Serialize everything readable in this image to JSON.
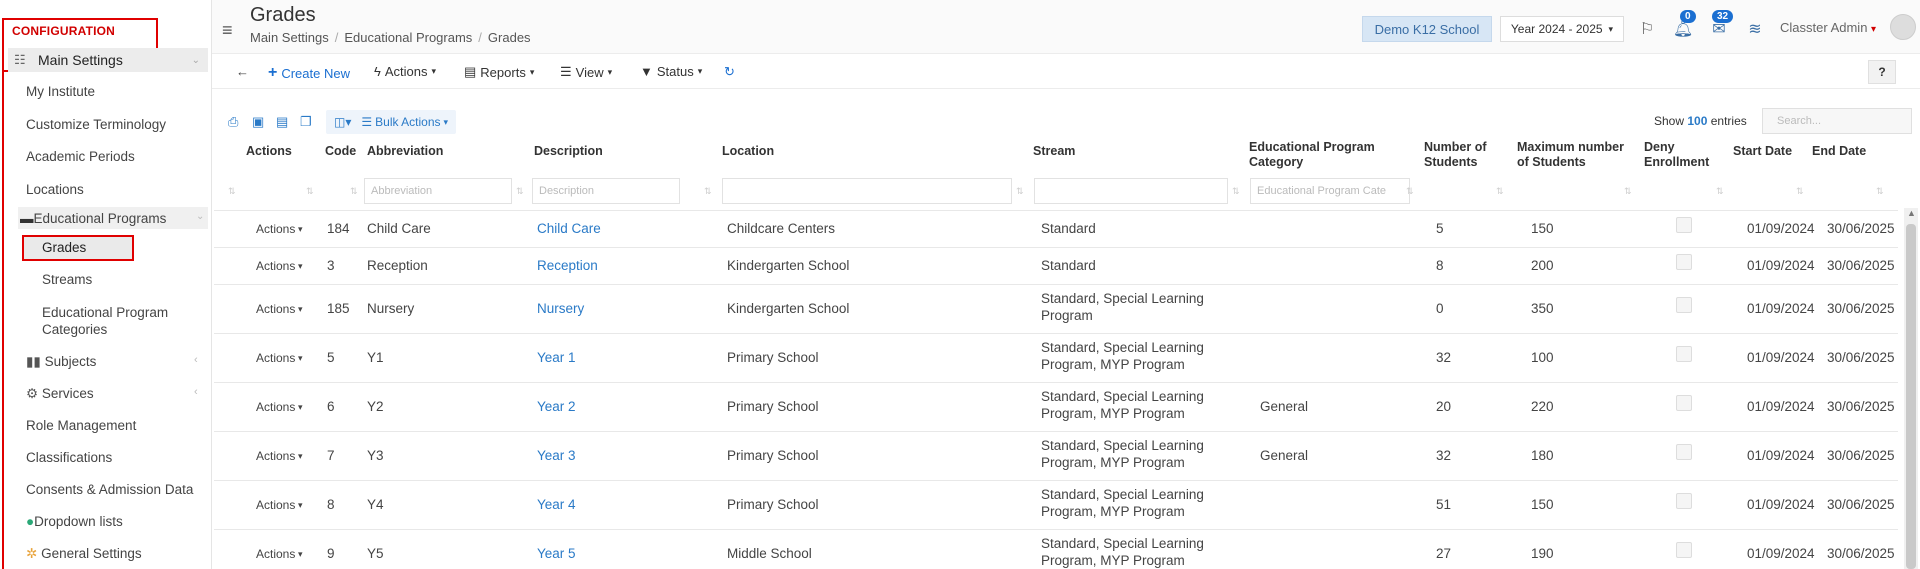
{
  "sidebar": {
    "section_title": "CONFIGURATION",
    "main_settings_label": "Main Settings",
    "items": [
      {
        "label": "My Institute"
      },
      {
        "label": "Customize Terminology"
      },
      {
        "label": "Academic Periods"
      },
      {
        "label": "Locations"
      },
      {
        "label": "Educational Programs"
      },
      {
        "label": "Grades"
      },
      {
        "label": "Streams"
      },
      {
        "label": "Educational Program Categories"
      },
      {
        "label": "Subjects"
      },
      {
        "label": "Services"
      },
      {
        "label": "Role Management"
      },
      {
        "label": "Classifications"
      },
      {
        "label": "Consents & Admission Data"
      },
      {
        "label": "Dropdown lists"
      },
      {
        "label": "General Settings"
      }
    ]
  },
  "header": {
    "title": "Grades",
    "breadcrumb": [
      "Main Settings",
      "Educational Programs",
      "Grades"
    ],
    "school": "Demo K12 School",
    "year": "Year 2024 - 2025",
    "notifications_count": "0",
    "messages_count": "32",
    "user": "Classter Admin"
  },
  "toolbar": {
    "create_new": "Create New",
    "actions": "Actions",
    "reports": "Reports",
    "view": "View",
    "status": "Status",
    "help": "?"
  },
  "table_controls": {
    "bulk_actions": "Bulk Actions",
    "show": "Show",
    "entries_count": "100",
    "entries": "entries",
    "search_placeholder": "Search..."
  },
  "table": {
    "headers": {
      "actions": "Actions",
      "code": "Code",
      "abbreviation": "Abbreviation",
      "description": "Description",
      "location": "Location",
      "stream": "Stream",
      "ep_category": "Educational Program Category",
      "num_students": "Number of Students",
      "max_students": "Maximum number of Students",
      "deny": "Deny Enrollment",
      "start": "Start Date",
      "end": "End Date"
    },
    "filters": {
      "abbreviation": "Abbreviation",
      "description": "Description",
      "ep_category": "Educational Program Cate"
    },
    "action_label": "Actions",
    "rows": [
      {
        "code": "184",
        "abbr": "Child Care",
        "desc": "Child Care",
        "location": "Childcare Centers",
        "stream": "Standard",
        "category": "",
        "num": "5",
        "max": "150",
        "start": "01/09/2024",
        "end": "30/06/2025"
      },
      {
        "code": "3",
        "abbr": "Reception",
        "desc": "Reception",
        "location": "Kindergarten School",
        "stream": "Standard",
        "category": "",
        "num": "8",
        "max": "200",
        "start": "01/09/2024",
        "end": "30/06/2025"
      },
      {
        "code": "185",
        "abbr": "Nursery",
        "desc": "Nursery",
        "location": "Kindergarten School",
        "stream": "Standard, Special Learning Program",
        "category": "",
        "num": "0",
        "max": "350",
        "start": "01/09/2024",
        "end": "30/06/2025"
      },
      {
        "code": "5",
        "abbr": "Y1",
        "desc": "Year 1",
        "location": "Primary School",
        "stream": "Standard, Special Learning Program, MYP Program",
        "category": "",
        "num": "32",
        "max": "100",
        "start": "01/09/2024",
        "end": "30/06/2025"
      },
      {
        "code": "6",
        "abbr": "Y2",
        "desc": "Year 2",
        "location": "Primary School",
        "stream": "Standard, Special Learning Program, MYP Program",
        "category": "General",
        "num": "20",
        "max": "220",
        "start": "01/09/2024",
        "end": "30/06/2025"
      },
      {
        "code": "7",
        "abbr": "Y3",
        "desc": "Year 3",
        "location": "Primary School",
        "stream": "Standard, Special Learning Program, MYP Program",
        "category": "General",
        "num": "32",
        "max": "180",
        "start": "01/09/2024",
        "end": "30/06/2025"
      },
      {
        "code": "8",
        "abbr": "Y4",
        "desc": "Year 4",
        "location": "Primary School",
        "stream": "Standard, Special Learning Program, MYP Program",
        "category": "",
        "num": "51",
        "max": "150",
        "start": "01/09/2024",
        "end": "30/06/2025"
      },
      {
        "code": "9",
        "abbr": "Y5",
        "desc": "Year 5",
        "location": "Middle School",
        "stream": "Standard, Special Learning Program, MYP Program",
        "category": "",
        "num": "27",
        "max": "190",
        "start": "01/09/2024",
        "end": "30/06/2025"
      }
    ]
  }
}
